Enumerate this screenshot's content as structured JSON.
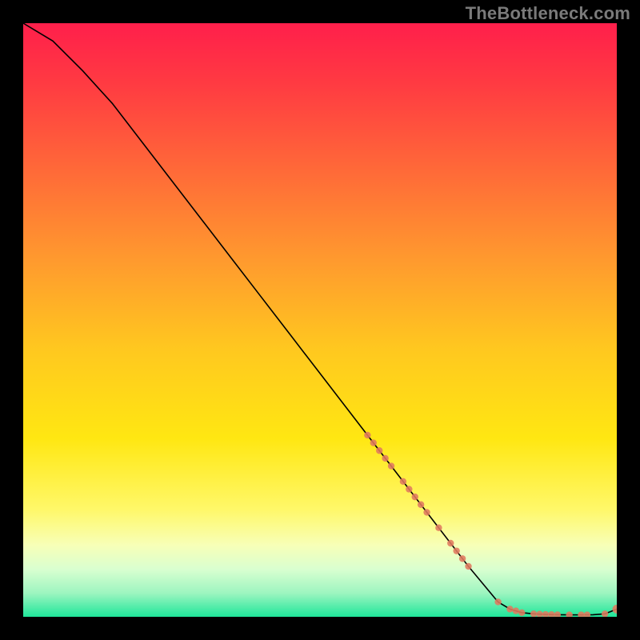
{
  "watermark": "TheBottleneck.com",
  "chart_data": {
    "type": "line",
    "title": "",
    "xlabel": "",
    "ylabel": "",
    "xlim": [
      0,
      100
    ],
    "ylim": [
      0,
      100
    ],
    "grid": false,
    "legend": false,
    "series": [
      {
        "name": "bottleneck-curve",
        "type": "line",
        "x": [
          0,
          5,
          10,
          15,
          20,
          25,
          30,
          35,
          40,
          45,
          50,
          55,
          60,
          65,
          70,
          75,
          80,
          82,
          84,
          86,
          88,
          90,
          92,
          94,
          96,
          98,
          100
        ],
        "values": [
          100,
          97,
          92,
          86.5,
          80,
          73.5,
          67,
          60.5,
          54,
          47.5,
          41,
          34.5,
          28,
          21.5,
          15,
          8.5,
          2.5,
          1.3,
          0.7,
          0.5,
          0.4,
          0.35,
          0.33,
          0.32,
          0.35,
          0.5,
          1.3
        ]
      },
      {
        "name": "marker-points",
        "type": "scatter",
        "x": [
          58,
          59,
          60,
          61,
          62,
          64,
          65,
          66,
          67,
          68,
          70,
          72,
          73,
          74,
          75,
          80,
          82,
          83,
          84,
          86,
          87,
          88,
          89,
          90,
          92,
          94,
          95,
          98,
          100
        ],
        "values": [
          30.6,
          29.3,
          28,
          26.7,
          25.4,
          22.8,
          21.5,
          20.2,
          18.9,
          17.6,
          15,
          12.4,
          11.1,
          9.8,
          8.5,
          2.5,
          1.3,
          1.0,
          0.7,
          0.5,
          0.45,
          0.4,
          0.37,
          0.35,
          0.33,
          0.32,
          0.33,
          0.5,
          1.3
        ]
      }
    ],
    "gradient_stops": [
      {
        "offset": 0.0,
        "color": "#ff1f4b"
      },
      {
        "offset": 0.1,
        "color": "#ff3a42"
      },
      {
        "offset": 0.25,
        "color": "#ff6a38"
      },
      {
        "offset": 0.4,
        "color": "#ff9a2e"
      },
      {
        "offset": 0.55,
        "color": "#ffc81f"
      },
      {
        "offset": 0.7,
        "color": "#ffe712"
      },
      {
        "offset": 0.82,
        "color": "#fff86a"
      },
      {
        "offset": 0.88,
        "color": "#f7ffb8"
      },
      {
        "offset": 0.92,
        "color": "#d9ffd0"
      },
      {
        "offset": 0.96,
        "color": "#9df5c0"
      },
      {
        "offset": 1.0,
        "color": "#1fe69a"
      }
    ],
    "marker_color": "#e07a5f"
  }
}
